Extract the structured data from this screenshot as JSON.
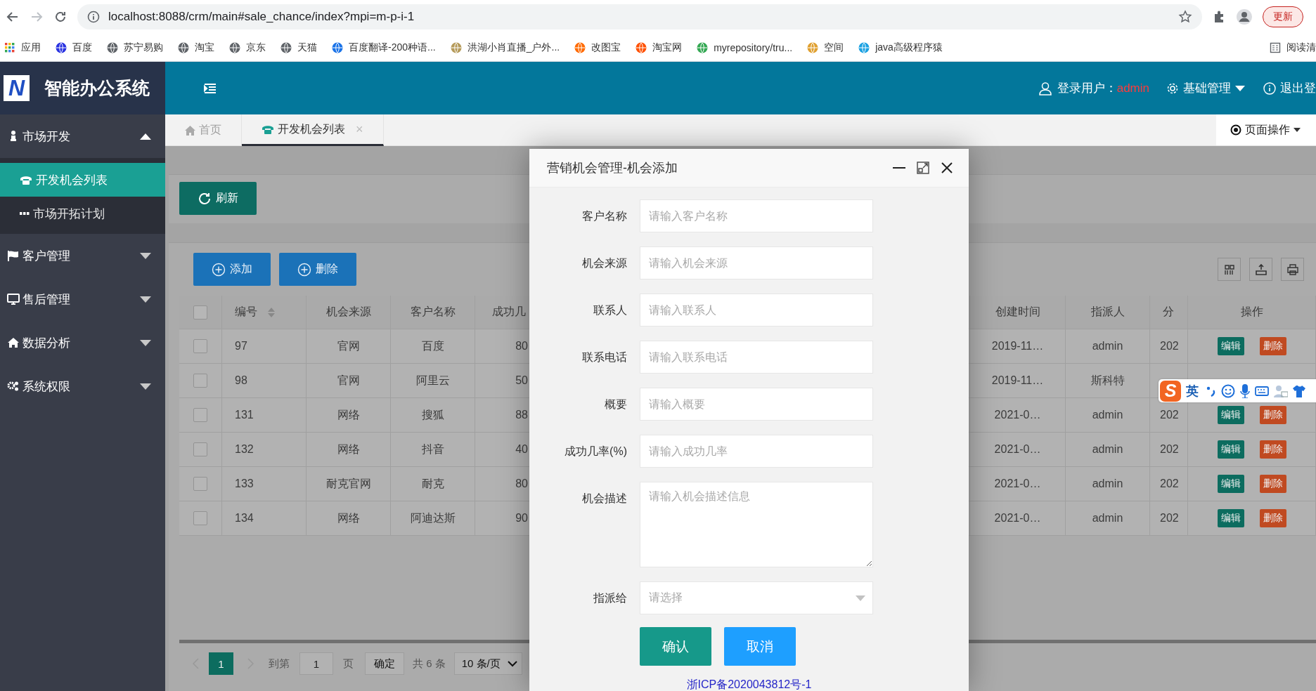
{
  "browser": {
    "url": "localhost:8088/crm/main#sale_chance/index?mpi=m-p-i-1",
    "update_button": "更新",
    "apps_label": "应用",
    "bookmarks": [
      {
        "label": "百度",
        "color": "#2932e1"
      },
      {
        "label": "苏宁易购",
        "color": "#5f6368"
      },
      {
        "label": "淘宝",
        "color": "#5f6368"
      },
      {
        "label": "京东",
        "color": "#5f6368"
      },
      {
        "label": "天猫",
        "color": "#5f6368"
      },
      {
        "label": "百度翻译-200种语...",
        "color": "#1a73e8"
      },
      {
        "label": "洪湖小肖直播_户外...",
        "color": "#b59a5a"
      },
      {
        "label": "改图宝",
        "color": "#ff6a00"
      },
      {
        "label": "淘宝网",
        "color": "#ff5000"
      },
      {
        "label": "myrepository/tru...",
        "color": "#34a853"
      },
      {
        "label": "空间",
        "color": "#e0a030"
      },
      {
        "label": "java高级程序猿",
        "color": "#1ba1e2"
      }
    ],
    "reading_list": "阅读清"
  },
  "header": {
    "logo_letter": "N",
    "title": "智能办公系统",
    "user_label": "登录用户：",
    "user_name": "admin",
    "menu": "基础管理",
    "logout": "退出登"
  },
  "sidebar": {
    "groups": [
      {
        "label": "市场开发",
        "expanded": true,
        "children": [
          {
            "label": "开发机会列表",
            "selected": true
          },
          {
            "label": "市场开拓计划",
            "selected": false
          }
        ]
      },
      {
        "label": "客户管理",
        "expanded": false
      },
      {
        "label": "售后管理",
        "expanded": false
      },
      {
        "label": "数据分析",
        "expanded": false
      },
      {
        "label": "系统权限",
        "expanded": false
      }
    ]
  },
  "tabs": [
    {
      "label": "首页",
      "selected": false
    },
    {
      "label": "开发机会列表",
      "selected": true,
      "close": "×"
    }
  ],
  "page_actions": "页面操作",
  "toolbar": {
    "refresh": "刷新",
    "add": "添加",
    "delete": "删除"
  },
  "table": {
    "header_checked": false,
    "columns": [
      {
        "label": "编号",
        "sortable": true
      },
      {
        "label": "机会来源",
        "sortable": false
      },
      {
        "label": "客户名称",
        "sortable": false
      },
      {
        "label": "成功几",
        "sortable": false
      },
      {
        "label": "创建时间",
        "sortable": false
      },
      {
        "label": "指派人",
        "sortable": false
      },
      {
        "label": "分",
        "sortable": false
      },
      {
        "label": "操作",
        "sortable": false
      }
    ],
    "rows": [
      {
        "checked": false,
        "cells": [
          "97",
          "官网",
          "百度",
          "80",
          "2019-11…",
          "admin",
          "202"
        ],
        "actions": [
          "编辑",
          "删除"
        ]
      },
      {
        "checked": false,
        "cells": [
          "98",
          "官网",
          "阿里云",
          "50",
          "2019-11…",
          "斯科特"
        ]
      },
      {
        "checked": false,
        "cells": [
          "131",
          "网络",
          "搜狐",
          "88",
          "2021-0…",
          "admin",
          "202"
        ],
        "actions": [
          "编辑",
          "删除"
        ]
      },
      {
        "checked": false,
        "cells": [
          "132",
          "网络",
          "抖音",
          "40",
          "2021-0…",
          "admin",
          "202"
        ],
        "actions": [
          "编辑",
          "删除"
        ]
      },
      {
        "checked": false,
        "cells": [
          "133",
          "耐克官网",
          "耐克",
          "80",
          "2021-0…",
          "admin",
          "202"
        ],
        "actions": [
          "编辑",
          "删除"
        ]
      },
      {
        "checked": false,
        "cells": [
          "134",
          "网络",
          "阿迪达斯",
          "90",
          "2021-0…",
          "admin",
          "202"
        ],
        "actions": [
          "编辑",
          "删除"
        ]
      }
    ]
  },
  "pagination": {
    "current": "1",
    "goto_label": "到第",
    "page_input": "1",
    "page_unit": "页",
    "confirm": "确定",
    "total": "共 6 条",
    "page_size": "10 条/页"
  },
  "dialog": {
    "title": "营销机会管理-机会添加",
    "fields": [
      {
        "label": "客户名称",
        "kind": "input",
        "placeholder": "请输入客户名称"
      },
      {
        "label": "机会来源",
        "kind": "input",
        "placeholder": "请输入机会来源"
      },
      {
        "label": "联系人",
        "kind": "input",
        "placeholder": "请输入联系人"
      },
      {
        "label": "联系电话",
        "kind": "input",
        "placeholder": "请输入联系电话"
      },
      {
        "label": "概要",
        "kind": "input",
        "placeholder": "请输入概要"
      },
      {
        "label": "成功几率(%)",
        "kind": "input",
        "placeholder": "请输入成功几率"
      },
      {
        "label": "机会描述",
        "kind": "textarea",
        "placeholder": "请输入机会描述信息"
      },
      {
        "label": "指派给",
        "kind": "select",
        "placeholder": "请选择"
      }
    ],
    "buttons": [
      {
        "label": "确认",
        "kind": "primary"
      },
      {
        "label": "取消",
        "kind": "normal"
      }
    ],
    "footer_link": "浙ICP备2020043812号-1"
  },
  "ime": {
    "logo": "S",
    "mode": "英"
  }
}
